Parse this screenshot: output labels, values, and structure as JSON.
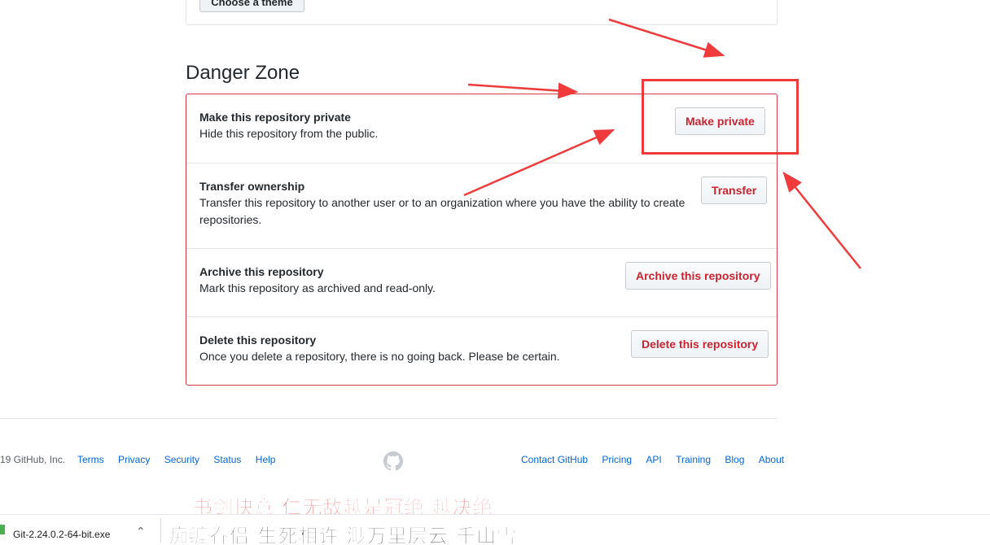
{
  "theme": {
    "button_label": "Choose a theme"
  },
  "danger_zone": {
    "title": "Danger Zone",
    "rows": [
      {
        "title": "Make this repository private",
        "description": "Hide this repository from the public.",
        "button": "Make private"
      },
      {
        "title": "Transfer ownership",
        "description": "Transfer this repository to another user or to an organization where you have the ability to create repositories.",
        "button": "Transfer"
      },
      {
        "title": "Archive this repository",
        "description": "Mark this repository as archived and read-only.",
        "button": "Archive this repository"
      },
      {
        "title": "Delete this repository",
        "description": "Once you delete a repository, there is no going back. Please be certain.",
        "button": "Delete this repository"
      }
    ]
  },
  "footer": {
    "copyright": "19 GitHub, Inc.",
    "left_links": [
      "Terms",
      "Privacy",
      "Security",
      "Status",
      "Help"
    ],
    "right_links": [
      "Contact GitHub",
      "Pricing",
      "API",
      "Training",
      "Blog",
      "About"
    ],
    "logo_icon": "github-octocat-icon"
  },
  "overlay": {
    "subtitle_line1": "书剑快意 仁无敌越是冠绝 越决绝",
    "subtitle_line2": "痴缠眷侣 生死相许 渺万里层云 千山雪",
    "annotation_color": "#ef3b3b"
  },
  "download_bar": {
    "file_name": "Git-2.24.0.2-64-bit.exe",
    "chevron_icon": "chevron-up-icon"
  },
  "colors": {
    "danger": "#d73a49",
    "danger_text": "#cb2431",
    "link": "#0366d6"
  }
}
